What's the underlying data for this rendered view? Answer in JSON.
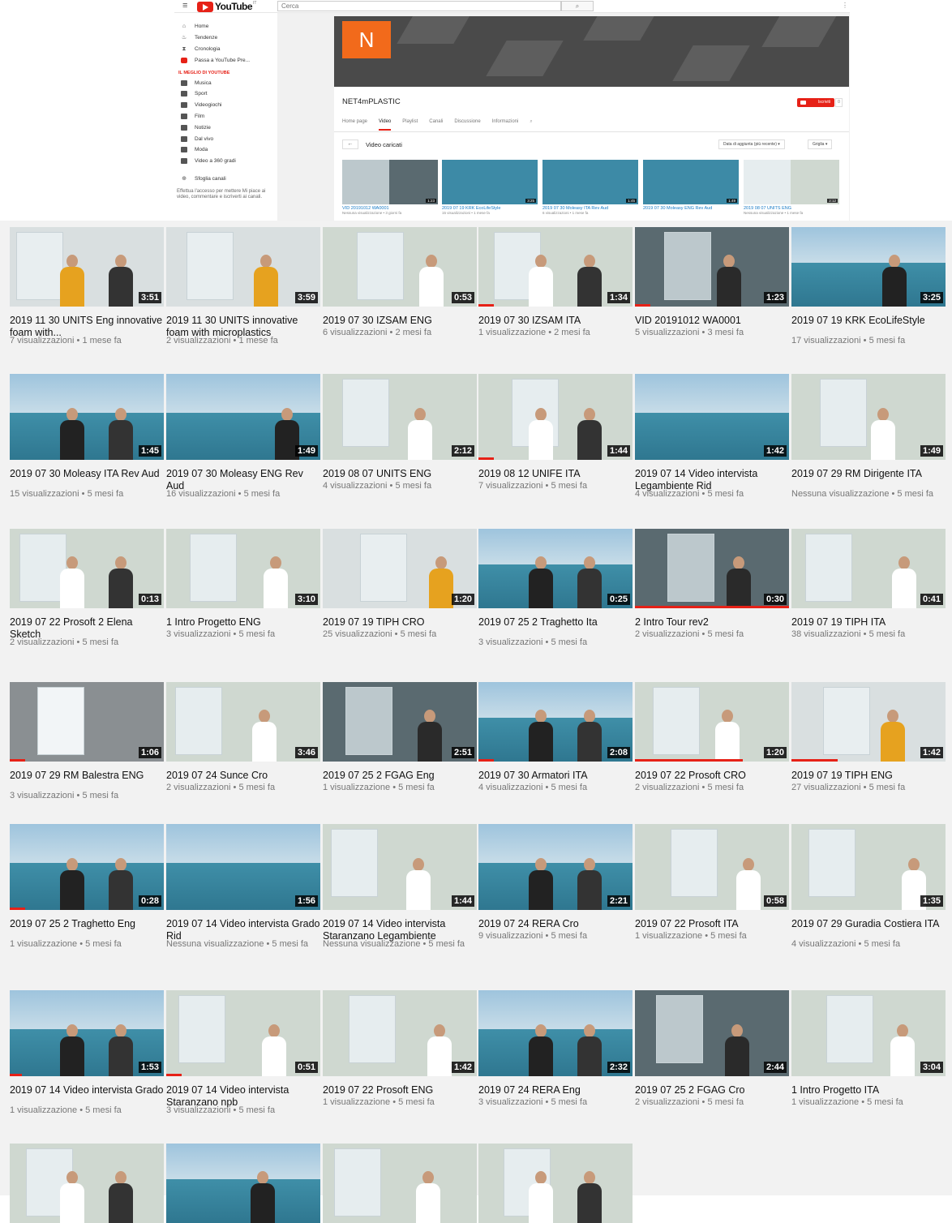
{
  "topbar": {
    "logo_text": "YouTube",
    "country": "IT",
    "search_placeholder": "Cerca",
    "search_icon": "search-icon"
  },
  "sidebar": {
    "items": [
      {
        "label": "Home",
        "icon": "home-icon"
      },
      {
        "label": "Tendenze",
        "icon": "flame-icon"
      },
      {
        "label": "Cronologia",
        "icon": "hourglass-icon"
      },
      {
        "label": "Passa a YouTube Pre...",
        "icon": "youtube-premium-icon"
      }
    ],
    "section_title": "IL MEGLIO DI YOUTUBE",
    "best_items": [
      {
        "label": "Musica",
        "icon": "music-icon"
      },
      {
        "label": "Sport",
        "icon": "sport-icon"
      },
      {
        "label": "Videogiochi",
        "icon": "gaming-icon"
      },
      {
        "label": "Film",
        "icon": "film-icon"
      },
      {
        "label": "Notizie",
        "icon": "news-icon"
      },
      {
        "label": "Dal vivo",
        "icon": "live-icon"
      },
      {
        "label": "Moda",
        "icon": "fashion-icon"
      },
      {
        "label": "Video a 360 gradi",
        "icon": "360-icon"
      }
    ],
    "browse_channels": "Sfoglia canali",
    "footer_text": "Effettua l'accesso per mettere Mi piace ai video, commentare e iscriverti ai canali."
  },
  "channel": {
    "avatar_letter": "N",
    "name": "NET4mPLASTIC",
    "subscribe_label": "Iscriviti",
    "sub_count": "0",
    "tabs": [
      "Home page",
      "Video",
      "Playlist",
      "Canali",
      "Discussione",
      "Informazioni"
    ],
    "active_tab": "Video",
    "back_label": "←",
    "uploaded_title": "Video caricati",
    "sort_label": "Data di aggiunta (più recente) ▾",
    "view_label": "Griglia ▾"
  },
  "mini_videos": [
    {
      "title": "VID 20191012 WA0001",
      "meta": "Nessuna visualizzazione • 3 giorni fa",
      "duration": "1:23"
    },
    {
      "title": "2019 07 19 KRK EcoLifeStyle",
      "meta": "15 visualizzazioni • 1 mese fa",
      "duration": "3:25"
    },
    {
      "title": "2019 07 30 Moleasy ITA Rev Aud",
      "meta": "6 visualizzazioni • 1 mese fa",
      "duration": "1:45"
    },
    {
      "title": "2019 07 30 Moleasy ENG Rev Aud",
      "meta": "",
      "duration": "1:49"
    },
    {
      "title": "2019 08 07 UNITS ENG",
      "meta": "Nessuna visualizzazione • 1 mese fa",
      "duration": "2:12"
    }
  ],
  "videos": [
    {
      "title": "2019 11 30 UNITS Eng innovative foam with...",
      "meta": "7 visualizzazioni • 1 mese fa",
      "duration": "3:51"
    },
    {
      "title": "2019 11 30 UNITS innovative foam with microplastics",
      "meta": "2 visualizzazioni • 1 mese fa",
      "duration": "3:59"
    },
    {
      "title": "2019 07 30 IZSAM ENG",
      "meta": "6 visualizzazioni • 2 mesi fa",
      "duration": "0:53"
    },
    {
      "title": "2019 07 30 IZSAM ITA",
      "meta": "1 visualizzazione • 2 mesi fa",
      "duration": "1:34"
    },
    {
      "title": "VID 20191012 WA0001",
      "meta": "5 visualizzazioni • 3 mesi fa",
      "duration": "1:23"
    },
    {
      "title": "2019 07 19 KRK EcoLifeStyle",
      "meta": "17 visualizzazioni • 5 mesi fa",
      "duration": "3:25"
    },
    {
      "title": "2019 07 30 Moleasy ITA Rev Aud",
      "meta": "15 visualizzazioni • 5 mesi fa",
      "duration": "1:45"
    },
    {
      "title": "2019 07 30 Moleasy ENG Rev Aud",
      "meta": "16 visualizzazioni • 5 mesi fa",
      "duration": "1:49"
    },
    {
      "title": "2019 08 07 UNITS ENG",
      "meta": "4 visualizzazioni • 5 mesi fa",
      "duration": "2:12"
    },
    {
      "title": "2019 08 12 UNIFE ITA",
      "meta": "7 visualizzazioni • 5 mesi fa",
      "duration": "1:44"
    },
    {
      "title": "2019 07 14 Video intervista Legambiente Rid",
      "meta": "4 visualizzazioni • 5 mesi fa",
      "duration": "1:42"
    },
    {
      "title": "2019 07 29 RM Dirigente ITA",
      "meta": "Nessuna visualizzazione • 5 mesi fa",
      "duration": "1:49"
    },
    {
      "title": "2019 07 22 Prosoft 2 Elena Sketch",
      "meta": "2 visualizzazioni • 5 mesi fa",
      "duration": "0:13"
    },
    {
      "title": "1 Intro Progetto ENG",
      "meta": "3 visualizzazioni • 5 mesi fa",
      "duration": "3:10"
    },
    {
      "title": "2019 07 19 TIPH CRO",
      "meta": "25 visualizzazioni • 5 mesi fa",
      "duration": "1:20"
    },
    {
      "title": "2019 07 25 2 Traghetto Ita",
      "meta": "3 visualizzazioni • 5 mesi fa",
      "duration": "0:25"
    },
    {
      "title": "2 Intro Tour rev2",
      "meta": "2 visualizzazioni • 5 mesi fa",
      "duration": "0:30"
    },
    {
      "title": "2019 07 19 TIPH ITA",
      "meta": "38 visualizzazioni • 5 mesi fa",
      "duration": "0:41"
    },
    {
      "title": "2019 07 29 RM Balestra ENG",
      "meta": "3 visualizzazioni • 5 mesi fa",
      "duration": "1:06"
    },
    {
      "title": "2019 07 24 Sunce Cro",
      "meta": "2 visualizzazioni • 5 mesi fa",
      "duration": "3:46"
    },
    {
      "title": "2019 07 25 2 FGAG Eng",
      "meta": "1 visualizzazione • 5 mesi fa",
      "duration": "2:51"
    },
    {
      "title": "2019 07 30 Armatori ITA",
      "meta": "4 visualizzazioni • 5 mesi fa",
      "duration": "2:08"
    },
    {
      "title": "2019 07 22 Prosoft CRO",
      "meta": "2 visualizzazioni • 5 mesi fa",
      "duration": "1:20"
    },
    {
      "title": "2019 07 19 TIPH ENG",
      "meta": "27 visualizzazioni • 5 mesi fa",
      "duration": "1:42"
    },
    {
      "title": "2019 07 25 2 Traghetto Eng",
      "meta": "1 visualizzazione • 5 mesi fa",
      "duration": "0:28"
    },
    {
      "title": "2019 07 14 Video intervista Grado Rid",
      "meta": "Nessuna visualizzazione • 5 mesi fa",
      "duration": "1:56"
    },
    {
      "title": "2019 07 14 Video intervista Staranzano Legambiente",
      "meta": "Nessuna visualizzazione • 5 mesi fa",
      "duration": "1:44"
    },
    {
      "title": "2019 07 24 RERA Cro",
      "meta": "9 visualizzazioni • 5 mesi fa",
      "duration": "2:21"
    },
    {
      "title": "2019 07 22 Prosoft ITA",
      "meta": "1 visualizzazione • 5 mesi fa",
      "duration": "0:58"
    },
    {
      "title": "2019 07 29 Guradia Costiera ITA",
      "meta": "4 visualizzazioni • 5 mesi fa",
      "duration": "1:35"
    },
    {
      "title": "2019 07 14 Video intervista Grado",
      "meta": "1 visualizzazione • 5 mesi fa",
      "duration": "1:53"
    },
    {
      "title": "2019 07 14 Video intervista Staranzano npb",
      "meta": "3 visualizzazioni • 5 mesi fa",
      "duration": "0:51"
    },
    {
      "title": "2019 07 22 Prosoft ENG",
      "meta": "1 visualizzazione • 5 mesi fa",
      "duration": "1:42"
    },
    {
      "title": "2019 07 24 RERA Eng",
      "meta": "3 visualizzazioni • 5 mesi fa",
      "duration": "2:32"
    },
    {
      "title": "2019 07 25 2 FGAG Cro",
      "meta": "2 visualizzazioni • 5 mesi fa",
      "duration": "2:44"
    },
    {
      "title": "1 Intro Progetto ITA",
      "meta": "1 visualizzazione • 5 mesi fa",
      "duration": "3:04"
    },
    {
      "title": "",
      "meta": "",
      "duration": ""
    },
    {
      "title": "",
      "meta": "",
      "duration": ""
    },
    {
      "title": "",
      "meta": "",
      "duration": ""
    },
    {
      "title": "",
      "meta": "",
      "duration": ""
    }
  ]
}
